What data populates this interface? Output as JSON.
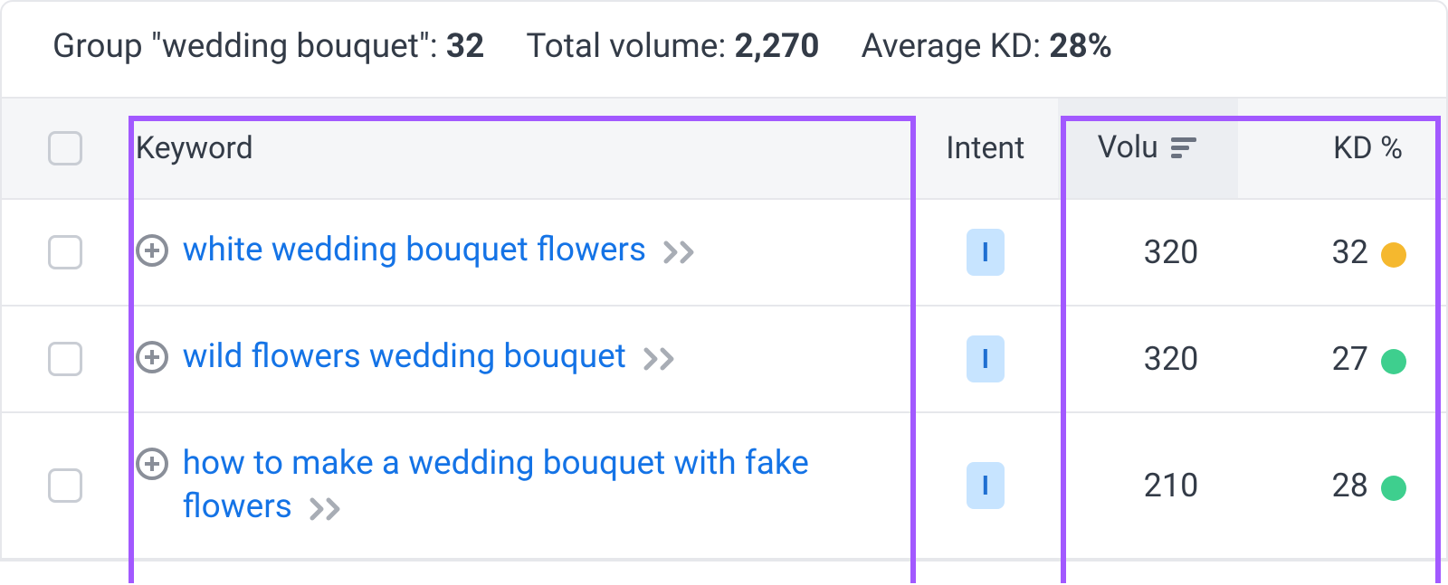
{
  "summary": {
    "group_label_prefix": "Group \"",
    "group_name": "wedding bouquet",
    "group_label_suffix": "\": ",
    "group_count": "32",
    "volume_label": "Total volume: ",
    "volume_value": "2,270",
    "kd_label": "Average KD: ",
    "kd_value": "28%"
  },
  "columns": {
    "keyword": "Keyword",
    "intent": "Intent",
    "volume": "Volu",
    "kd": "KD %"
  },
  "rows": [
    {
      "keyword": "white wedding bouquet flowers",
      "intent": "I",
      "volume": "320",
      "kd": "32",
      "kd_color": "#f5b82e"
    },
    {
      "keyword": "wild flowers wedding bouquet",
      "intent": "I",
      "volume": "320",
      "kd": "27",
      "kd_color": "#3ecf8e"
    },
    {
      "keyword": "how to make a wedding bouquet with fake flowers",
      "intent": "I",
      "volume": "210",
      "kd": "28",
      "kd_color": "#3ecf8e"
    }
  ],
  "colors": {
    "highlight": "#a259ff"
  }
}
